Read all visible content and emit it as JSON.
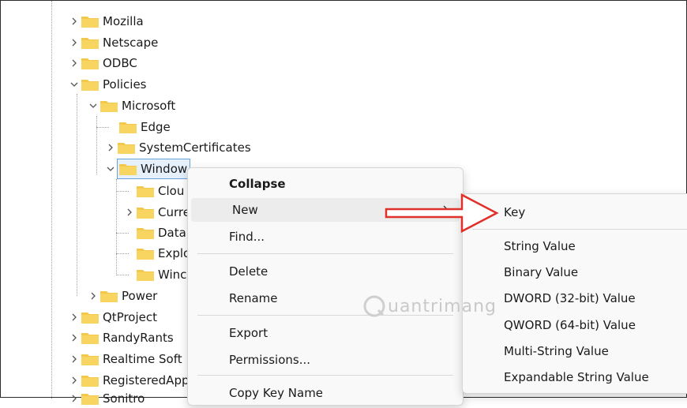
{
  "tree": {
    "items": [
      {
        "label": "Mozilla",
        "expanded": false
      },
      {
        "label": "Netscape",
        "expanded": false
      },
      {
        "label": "ODBC",
        "expanded": false
      },
      {
        "label": "Policies",
        "expanded": true
      },
      {
        "label": "Microsoft",
        "expanded": true
      },
      {
        "label": "Edge",
        "expanded": false
      },
      {
        "label": "SystemCertificates",
        "expanded": false
      },
      {
        "label": "Window",
        "expanded": true,
        "selected": true
      },
      {
        "label": "Clou"
      },
      {
        "label": "Curre",
        "expanded": false
      },
      {
        "label": "Data"
      },
      {
        "label": "Explo"
      },
      {
        "label": "Winc"
      },
      {
        "label": "Power",
        "expanded": false
      },
      {
        "label": "QtProject",
        "expanded": false
      },
      {
        "label": "RandyRants",
        "expanded": false
      },
      {
        "label": "Realtime Soft",
        "expanded": false
      },
      {
        "label": "RegisteredApp",
        "expanded": false
      },
      {
        "label": "Sonitro",
        "expanded": false
      }
    ]
  },
  "context_menu": {
    "collapse": "Collapse",
    "new": "New",
    "find": "Find...",
    "delete": "Delete",
    "rename": "Rename",
    "export": "Export",
    "permissions": "Permissions...",
    "copy_key_name": "Copy Key Name"
  },
  "submenu": {
    "key": "Key",
    "string_value": "String Value",
    "binary_value": "Binary Value",
    "dword": "DWORD (32-bit) Value",
    "qword": "QWORD (64-bit) Value",
    "multi_string": "Multi-String Value",
    "expandable_string": "Expandable String Value"
  },
  "watermark": "uantrimang",
  "colors": {
    "folder": "#f4c84a",
    "arrow": "#e0302a",
    "selection": "#e5f0fb"
  }
}
